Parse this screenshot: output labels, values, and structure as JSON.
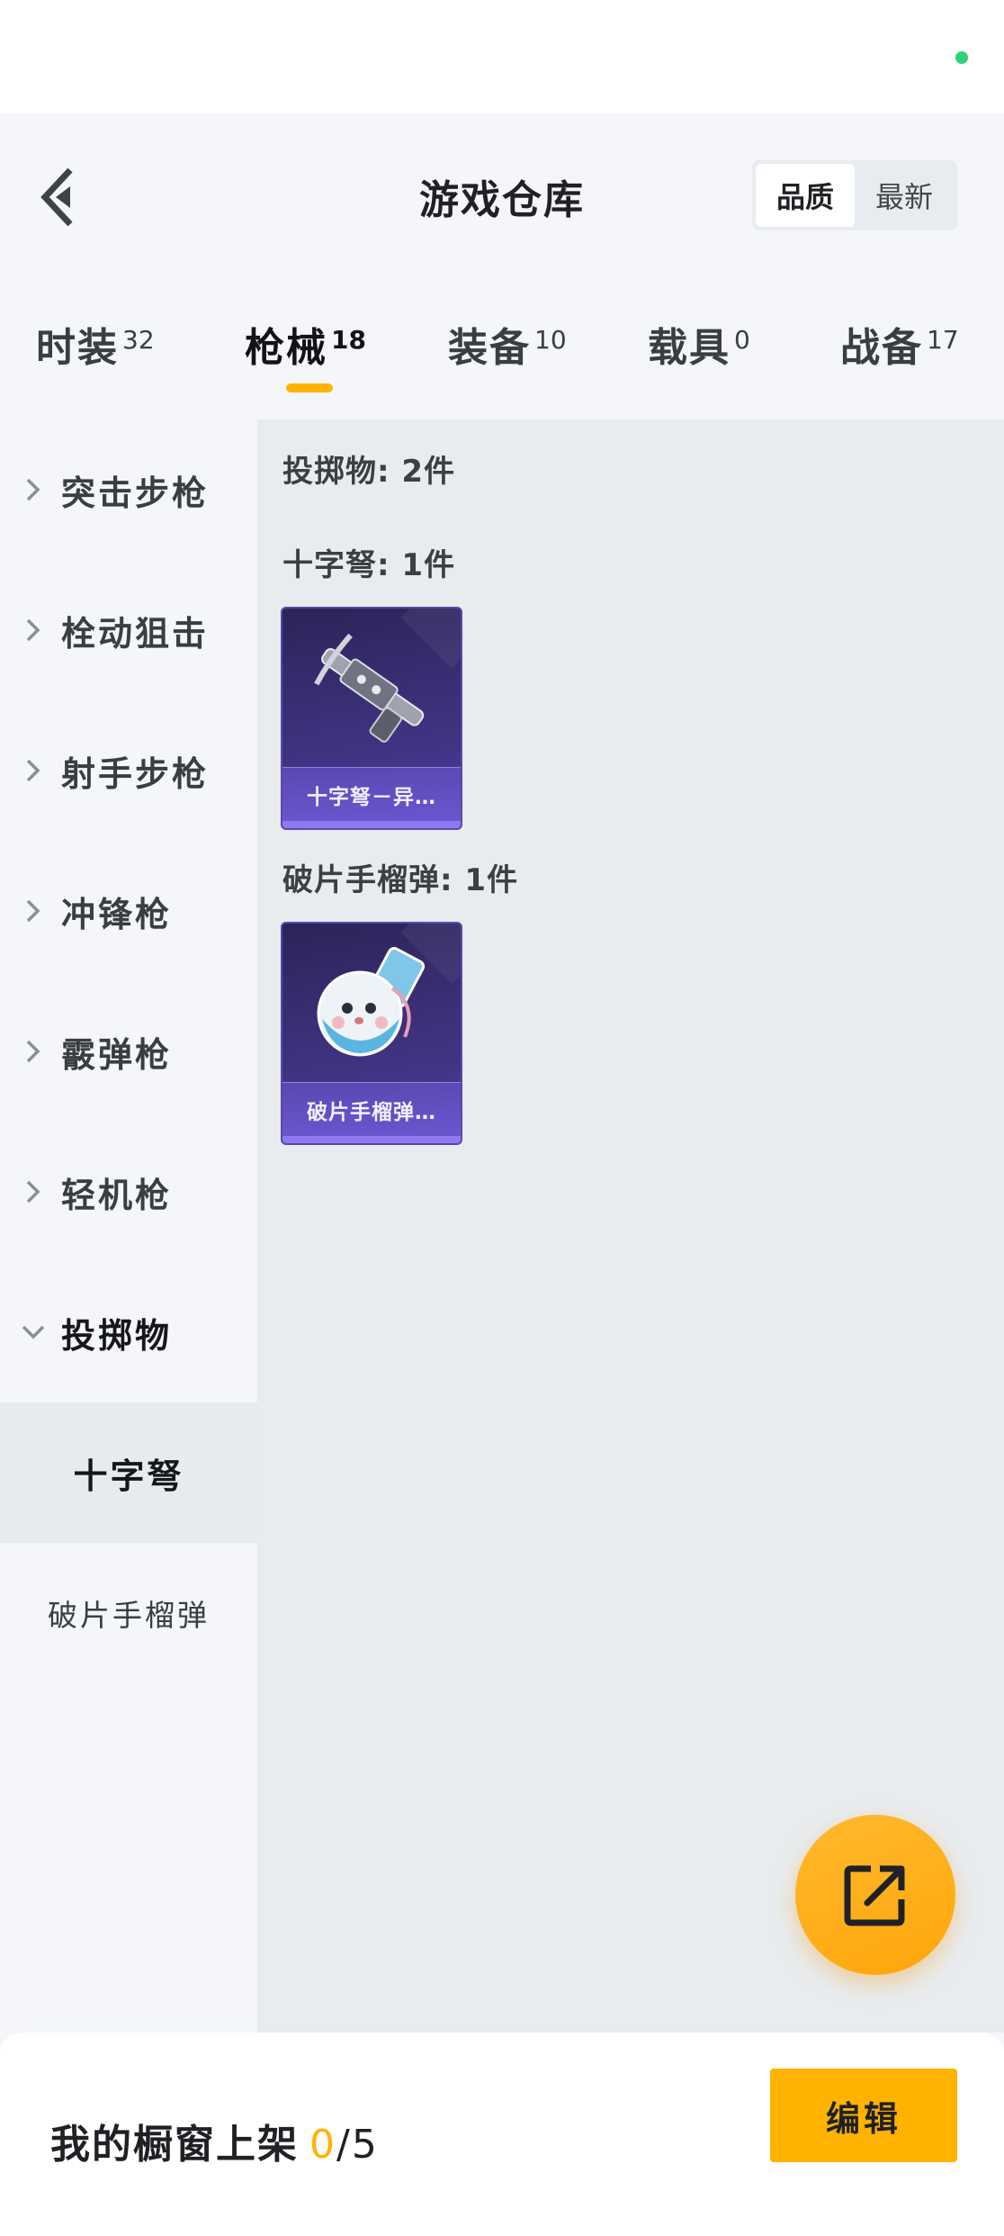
{
  "header": {
    "title": "游戏仓库",
    "sort_options": [
      "品质",
      "最新"
    ],
    "sort_active": "品质"
  },
  "tabs": [
    {
      "label": "时装",
      "count": "32"
    },
    {
      "label": "枪械",
      "count": "18"
    },
    {
      "label": "装备",
      "count": "10"
    },
    {
      "label": "载具",
      "count": "0"
    },
    {
      "label": "战备",
      "count": "17"
    }
  ],
  "active_tab": "枪械",
  "sidebar": {
    "items": [
      {
        "label": "突击步枪"
      },
      {
        "label": "栓动狙击"
      },
      {
        "label": "射手步枪"
      },
      {
        "label": "冲锋枪"
      },
      {
        "label": "霰弹枪"
      },
      {
        "label": "轻机枪"
      },
      {
        "label": "投掷物"
      }
    ],
    "subitems": [
      {
        "label": "十字弩"
      },
      {
        "label": "破片手榴弹"
      }
    ]
  },
  "content": {
    "category_summary": "投掷物: 2件",
    "groups": [
      {
        "title": "十字弩: 1件",
        "item_name": "十字弩－异…",
        "icon": "crossbow-icon"
      },
      {
        "title": "破片手榴弹: 1件",
        "item_name": "破片手榴弹…",
        "icon": "grenade-icon"
      }
    ]
  },
  "bottom": {
    "shelf_label": "我的橱窗上架",
    "shelf_current": "0",
    "shelf_total": "/5",
    "edit_label": "编辑"
  },
  "colors": {
    "accent": "#ffb300",
    "card_purple": "#3b2f78",
    "status_dot": "#2fd27a"
  }
}
